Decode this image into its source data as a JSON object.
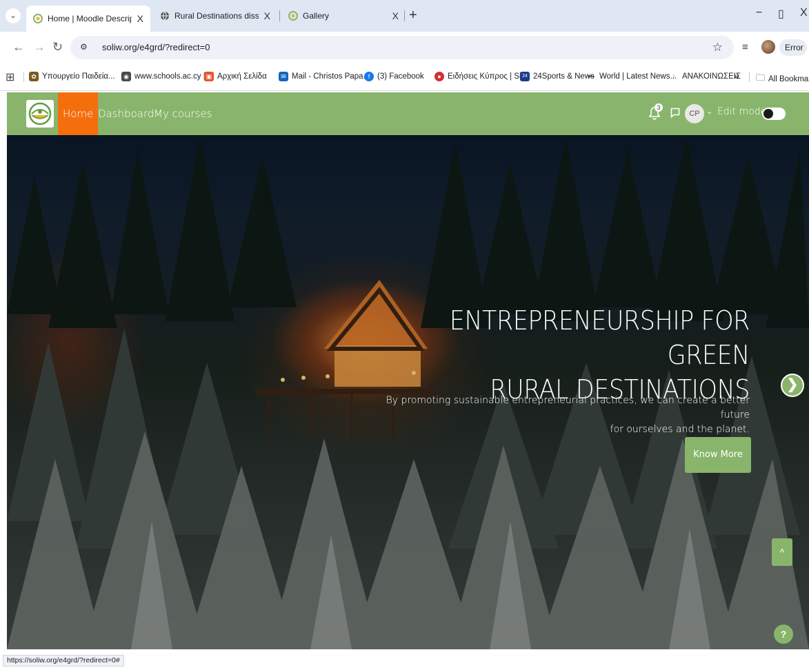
{
  "browser": {
    "tabs": [
      {
        "label": "Home | Moodle Description",
        "close": "X",
        "active": true
      },
      {
        "label": "Rural Destinations dissemination",
        "close": "X",
        "active": false
      },
      {
        "label": "Gallery",
        "close": "X",
        "active": false
      }
    ],
    "new_tab": "+",
    "window_controls": {
      "minimize": "−",
      "restore": "▯",
      "close": "X"
    },
    "url": "soliw.org/e4grd/?redirect=0",
    "error_label": "Error",
    "bookmarks": [
      {
        "label": "Υπουργείο Παιδεία...",
        "color": "#7a5c1d",
        "glyph": "✿"
      },
      {
        "label": "www.schools.ac.cy |...",
        "color": "#4a4a4a",
        "glyph": "◉"
      },
      {
        "label": "Αρχική Σελίδα",
        "color": "#e8542c",
        "glyph": "▣"
      },
      {
        "label": "Mail - Christos Papa...",
        "color": "#1565c0",
        "glyph": "✉"
      },
      {
        "label": "(3) Facebook",
        "color": "#1877f2",
        "glyph": "f"
      },
      {
        "label": "Ειδήσεις Κύπρος | Si...",
        "color": "#d32f2f",
        "glyph": "●"
      },
      {
        "label": "24Sports & News",
        "color": "#1e3a8a",
        "glyph": "24"
      },
      {
        "label": "World | Latest News...",
        "color": "#222222",
        "glyph": "•••"
      },
      {
        "label": "ΑΝΑΚΟΙΝΩΣΕΙΣ",
        "color": "#c89b3c",
        "glyph": "i"
      }
    ],
    "bookmarks_overflow": "»",
    "all_bookmarks": "All Bookmarks",
    "status_url": "https://soliw.org/e4grd/?redirect=0#"
  },
  "navbar": {
    "links": [
      "Home",
      "Dashboard",
      "My courses"
    ],
    "notification_count": "3",
    "user_initials": "CP",
    "edit_mode_label": "Edit mode"
  },
  "hero": {
    "title_line1": "ENTREPRENEURSHIP FOR GREEN",
    "title_line2": "RURAL DESTINATIONS",
    "subtitle_line1": "By promoting sustainable entrepreneurial practices, we can create a better future",
    "subtitle_line2": "for ourselves and the planet.",
    "button_label": "Know More",
    "next_glyph": "❯",
    "top_glyph": "^",
    "help_glyph": "?"
  },
  "theme": {
    "accent_green": "#88b56b",
    "active_orange": "#f56e0e"
  }
}
